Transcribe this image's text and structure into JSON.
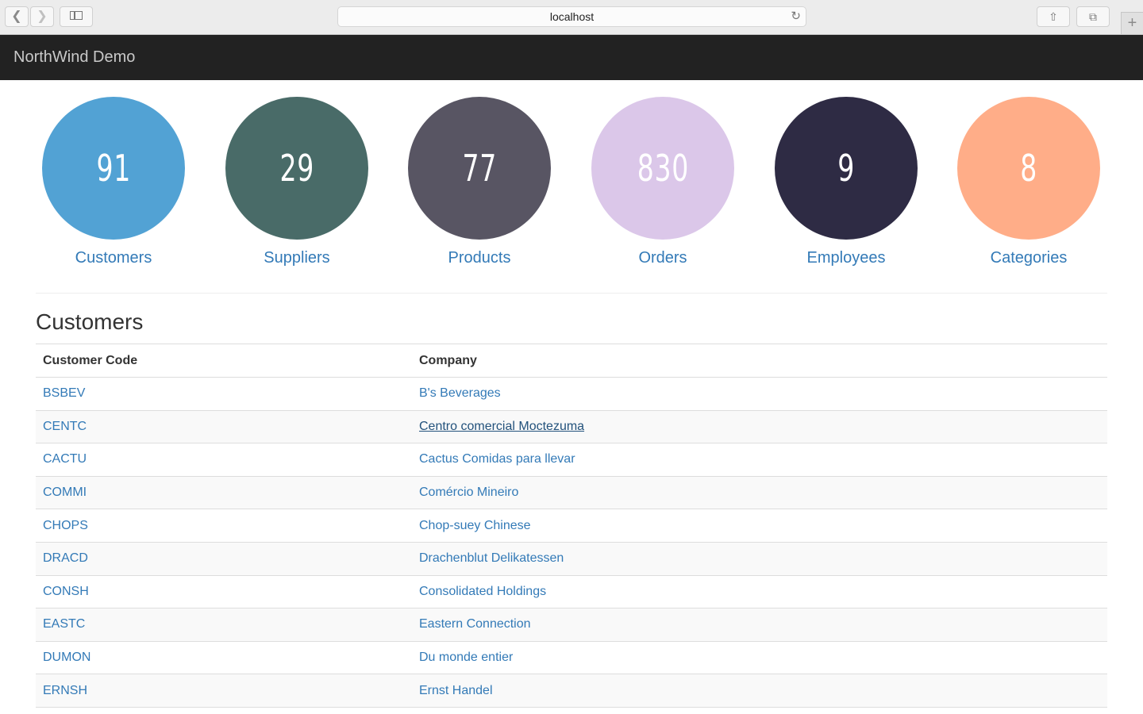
{
  "browser": {
    "url": "localhost",
    "back_icon": "chevron-left-icon",
    "forward_icon": "chevron-right-icon",
    "reload_icon": "reload-icon"
  },
  "navbar": {
    "brand": "NorthWind Demo"
  },
  "stats": [
    {
      "count": "91",
      "label": "Customers",
      "color": "#52a2d4"
    },
    {
      "count": "29",
      "label": "Suppliers",
      "color": "#496b68"
    },
    {
      "count": "77",
      "label": "Products",
      "color": "#585563"
    },
    {
      "count": "830",
      "label": "Orders",
      "color": "#dbc7e9"
    },
    {
      "count": "9",
      "label": "Employees",
      "color": "#2e2b44"
    },
    {
      "count": "8",
      "label": "Categories",
      "color": "#ffad88"
    }
  ],
  "section": {
    "title": "Customers"
  },
  "table": {
    "headers": [
      "Customer Code",
      "Company"
    ],
    "rows": [
      {
        "code": "BSBEV",
        "company": "B's Beverages"
      },
      {
        "code": "CENTC",
        "company": "Centro comercial Moctezuma"
      },
      {
        "code": "CACTU",
        "company": "Cactus Comidas para llevar"
      },
      {
        "code": "COMMI",
        "company": "Comércio Mineiro"
      },
      {
        "code": "CHOPS",
        "company": "Chop-suey Chinese"
      },
      {
        "code": "DRACD",
        "company": "Drachenblut Delikatessen"
      },
      {
        "code": "CONSH",
        "company": "Consolidated Holdings"
      },
      {
        "code": "EASTC",
        "company": "Eastern Connection"
      },
      {
        "code": "DUMON",
        "company": "Du monde entier"
      },
      {
        "code": "ERNSH",
        "company": "Ernst Handel"
      }
    ]
  }
}
